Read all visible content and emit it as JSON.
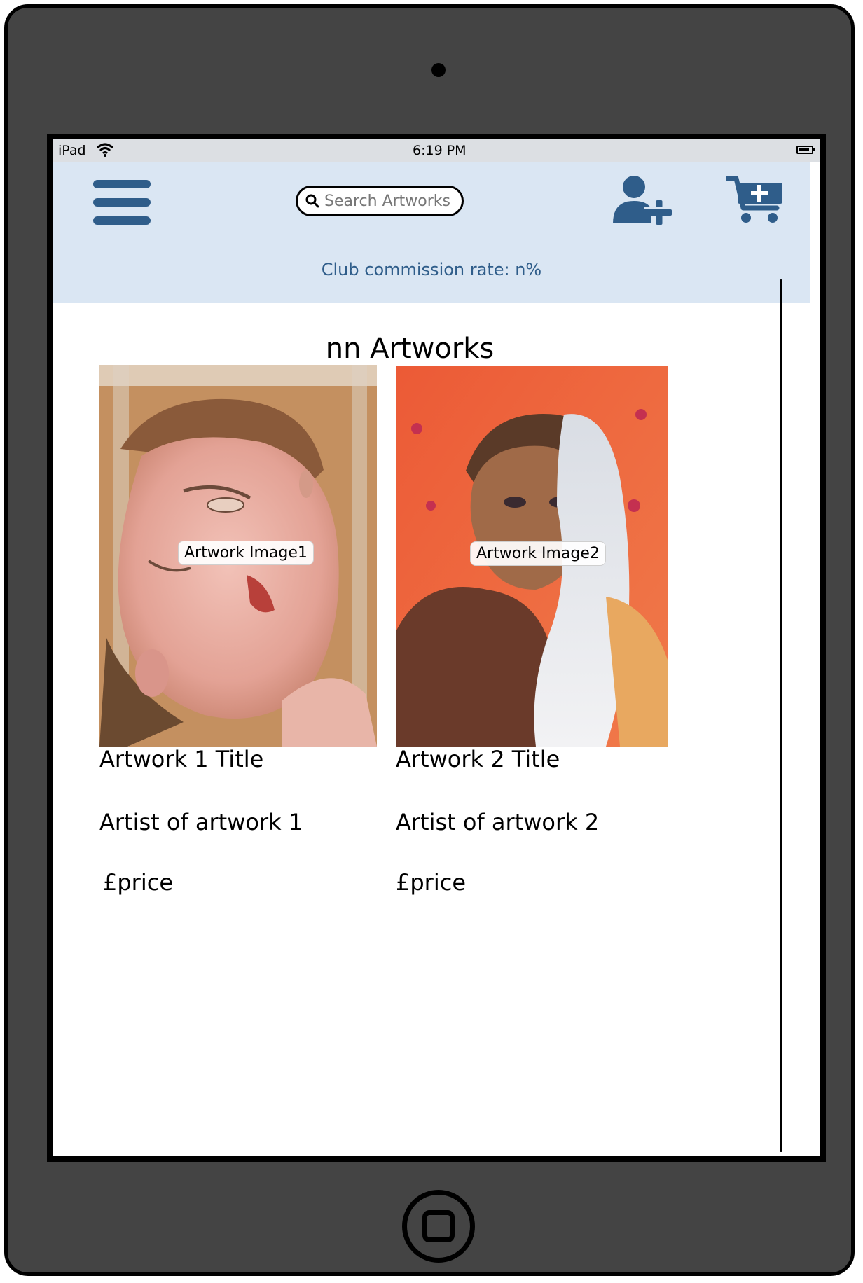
{
  "status_bar": {
    "device": "iPad",
    "time": "6:19 PM"
  },
  "header": {
    "search_placeholder": "Search Artworks",
    "commission_text": "Club commission rate: n%"
  },
  "main": {
    "title": "nn Artworks",
    "artworks": [
      {
        "image_label": "Artwork Image1",
        "title": "Artwork 1 Title",
        "artist": "Artist of artwork 1",
        "price": "£price"
      },
      {
        "image_label": "Artwork Image2",
        "title": "Artwork 2 Title",
        "artist": "Artist of artwork 2",
        "price": "£price"
      }
    ]
  },
  "colors": {
    "device_frame": "#444444",
    "status_bar": "#dcdfe3",
    "app_bar": "#dae6f3",
    "accent": "#2f5d8a"
  },
  "icons": [
    "wifi-icon",
    "battery-icon",
    "menu-icon",
    "search-icon",
    "add-user-icon",
    "cart-add-icon",
    "home-button-icon"
  ]
}
